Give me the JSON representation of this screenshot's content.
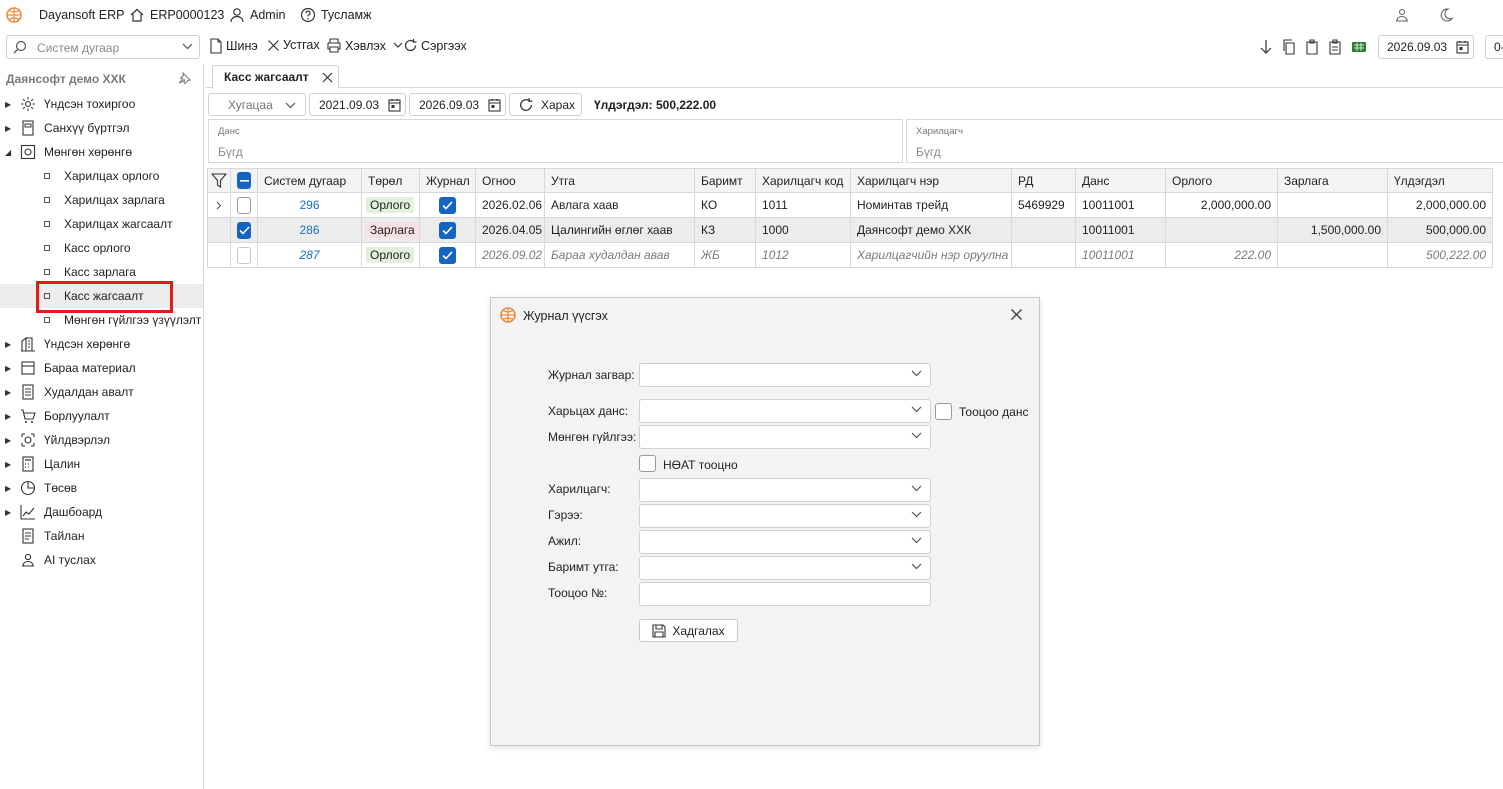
{
  "titlebar": {
    "app_name": "Dayansoft ERP",
    "doc_code": "ERP0000123",
    "user": "Admin",
    "help": "Тусламж"
  },
  "toolbar": {
    "search_placeholder": "Систем дугаар",
    "new_label": "Шинэ",
    "delete_label": "Устгах",
    "print_label": "Хэвлэх",
    "refresh_label": "Сэргээх",
    "date": "2026.09.03",
    "cut_label": "0-"
  },
  "sidebar": {
    "title": "Даянсофт демо ХХК",
    "items": [
      {
        "label": "Үндсэн тохиргоо",
        "icon": "gear-icon"
      },
      {
        "label": "Санхүү бүртгэл",
        "icon": "book-icon"
      },
      {
        "label": "Мөнгөн хөрөнгө",
        "icon": "safe-icon"
      },
      {
        "label": "Үндсэн хөрөнгө",
        "icon": "building-icon"
      },
      {
        "label": "Бараа материал",
        "icon": "box-icon"
      },
      {
        "label": "Худалдан авалт",
        "icon": "list-icon"
      },
      {
        "label": "Борлуулалт",
        "icon": "cart-icon"
      },
      {
        "label": "Үйлдвэрлэл",
        "icon": "factory-icon"
      },
      {
        "label": "Цалин",
        "icon": "calculator-icon"
      },
      {
        "label": "Төсөв",
        "icon": "pie-icon"
      },
      {
        "label": "Дашбоард",
        "icon": "chart-icon"
      },
      {
        "label": "Тайлан",
        "icon": "report-icon"
      },
      {
        "label": "AI туслах",
        "icon": "robot-icon"
      }
    ],
    "subitems": [
      "Харилцах орлого",
      "Харилцах зарлага",
      "Харилцах жагсаалт",
      "Касс орлого",
      "Касс зарлага",
      "Касс жагсаалт",
      "Мөнгөн гүйлгээ үзүүлэлт"
    ]
  },
  "tab": {
    "label": "Касс жагсаалт"
  },
  "filters": {
    "period": "Хугацаа",
    "date_from": "2021.09.03",
    "date_to": "2026.09.03",
    "view_label": "Харах",
    "balance": "Үлдэгдэл: 500,222.00",
    "account_caption": "Данс",
    "account_value": "Бүгд",
    "partner_caption": "Харилцагч",
    "partner_value": "Бүгд"
  },
  "grid": {
    "headers": [
      "Систем дугаар",
      "Төрөл",
      "Журнал",
      "Огноо",
      "Утга",
      "Баримт",
      "Харилцагч код",
      "Харилцагч нэр",
      "РД",
      "Данс",
      "Орлого",
      "Зарлага",
      "Үлдэгдэл"
    ],
    "rows": [
      {
        "sys": "296",
        "type": "Орлого",
        "date": "2026.02.06",
        "desc": "Авлага хаав",
        "doc": "КО",
        "pcode": "1011",
        "pname": "Номинтав трейд",
        "rd": "5469929",
        "acct": "10011001",
        "income": "2,000,000.00",
        "expense": "",
        "balance": "2,000,000.00"
      },
      {
        "sys": "286",
        "type": "Зарлага",
        "date": "2026.04.05",
        "desc": "Цалингийн өглөг хаав",
        "doc": "КЗ",
        "pcode": "1000",
        "pname": "Даянсофт демо ХХК",
        "rd": "",
        "acct": "10011001",
        "income": "",
        "expense": "1,500,000.00",
        "balance": "500,000.00"
      },
      {
        "sys": "287",
        "type": "Орлого",
        "date": "2026.09.02",
        "desc": "Бараа худалдан авав",
        "doc": "ЖБ",
        "pcode": "1012",
        "pname": "Харилцагчийн нэр оруулна",
        "rd": "",
        "acct": "10011001",
        "income": "222.00",
        "expense": "",
        "balance": "500,222.00"
      }
    ]
  },
  "dialog": {
    "title": "Журнал үүсгэх",
    "template_label": "Журнал загвар:",
    "corr_account_label": "Харьцах данс:",
    "calc_account_label": "Тооцоо данс",
    "cash_flow_label": "Мөнгөн гүйлгээ:",
    "vat_label": "НӨАТ тооцно",
    "partner_label": "Харилцагч:",
    "contract_label": "Гэрээ:",
    "job_label": "Ажил:",
    "doc_desc_label": "Баримт утга:",
    "calc_no_label": "Тооцоо №:",
    "save_label": "Хадгалах"
  },
  "colors": {
    "accent": "#1565c0",
    "link": "#1a6ec4",
    "income_tag_bg": "#e3f0dc",
    "expense_tag_bg": "#f8e1e1",
    "highlight": "#e21a1a",
    "logo": "#f08a3c"
  }
}
